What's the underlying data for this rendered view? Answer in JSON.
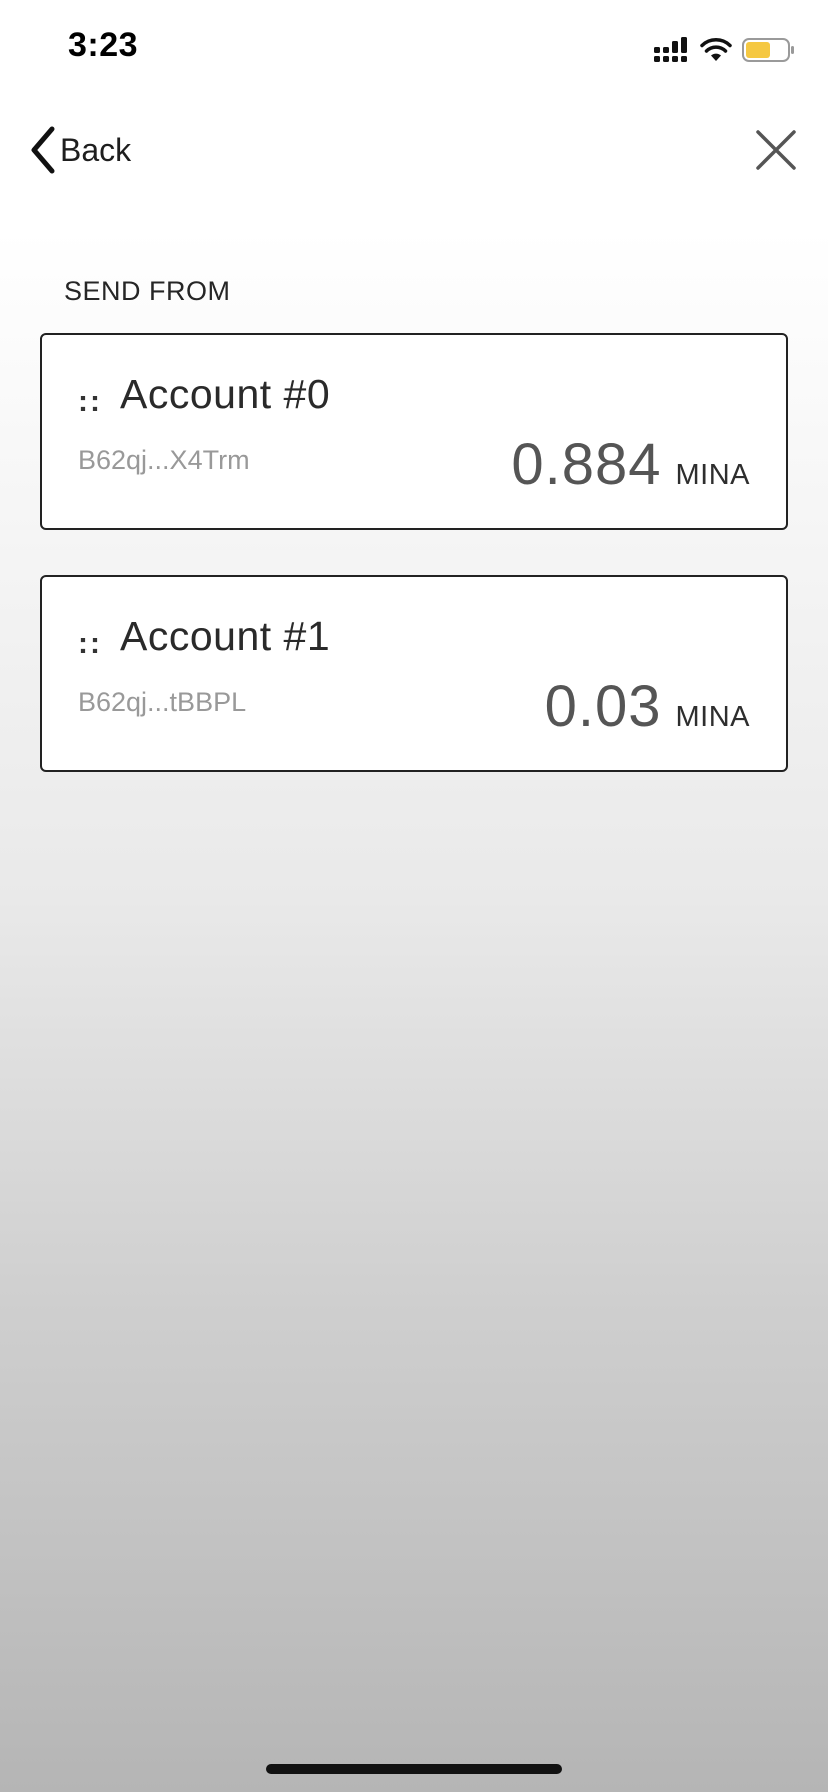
{
  "status_bar": {
    "time": "3:23",
    "icons": [
      "signal-icon",
      "wifi-icon",
      "battery-icon"
    ],
    "battery_color": "#f5c842"
  },
  "nav": {
    "back_label": "Back",
    "back_icon": "chevron-left-icon",
    "close_icon": "close-icon"
  },
  "section": {
    "label": "SEND FROM"
  },
  "accounts": [
    {
      "handle": "::",
      "name": "Account #0",
      "address": "B62qj...X4Trm",
      "balance": "0.884",
      "unit": "MINA"
    },
    {
      "handle": "::",
      "name": "Account #1",
      "address": "B62qj...tBBPL",
      "balance": "0.03",
      "unit": "MINA"
    }
  ]
}
